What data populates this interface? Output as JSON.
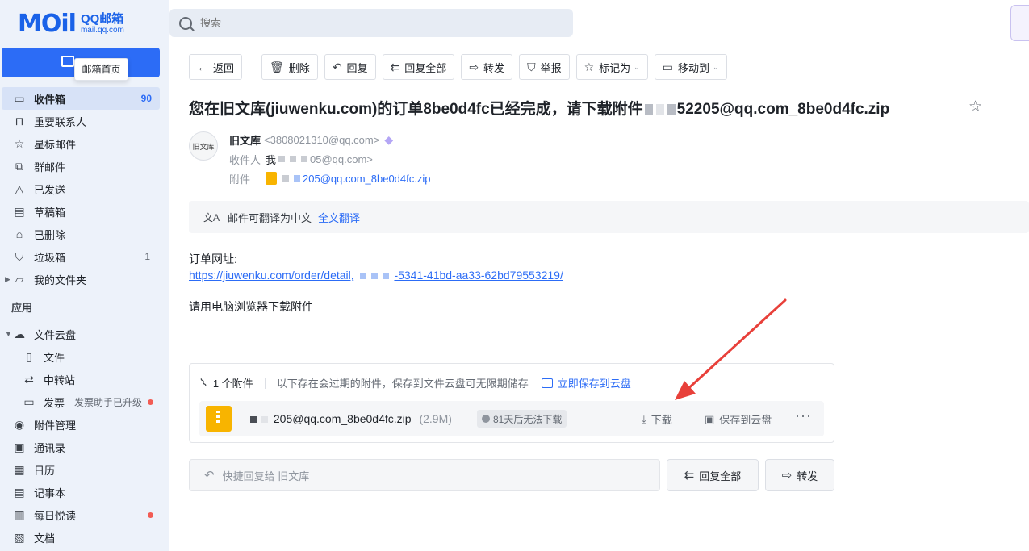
{
  "brand": {
    "mark": "MOil",
    "title": "QQ邮箱",
    "subtitle": "mail.qq.com"
  },
  "tooltip": "邮箱首页",
  "search": {
    "placeholder": "搜索"
  },
  "nav": [
    {
      "label": "收件箱",
      "count": "90",
      "icon": "inbox-icon",
      "active": true
    },
    {
      "label": "重要联系人",
      "count": "",
      "icon": "bookmark-icon"
    },
    {
      "label": "星标邮件",
      "count": "",
      "icon": "star-icon"
    },
    {
      "label": "群邮件",
      "count": "",
      "icon": "group-mail-icon"
    },
    {
      "label": "已发送",
      "count": "",
      "icon": "send-icon"
    },
    {
      "label": "草稿箱",
      "count": "",
      "icon": "draft-icon"
    },
    {
      "label": "已删除",
      "count": "",
      "icon": "trash-icon"
    },
    {
      "label": "垃圾箱",
      "count": "1",
      "icon": "spam-shield-icon"
    },
    {
      "label": "我的文件夹",
      "count": "",
      "icon": "folder-icon"
    }
  ],
  "apps": {
    "title": "应用",
    "items": [
      {
        "label": "文件云盘",
        "icon": "cloud-disk-icon"
      },
      {
        "label": "文件",
        "icon": "file-icon"
      },
      {
        "label": "中转站",
        "icon": "transfer-icon"
      },
      {
        "label": "发票",
        "note": "发票助手已升级",
        "icon": "invoice-icon"
      },
      {
        "label": "附件管理",
        "icon": "attachment-manage-icon"
      },
      {
        "label": "通讯录",
        "icon": "contacts-icon"
      },
      {
        "label": "日历",
        "icon": "calendar-icon"
      },
      {
        "label": "记事本",
        "icon": "notepad-icon"
      },
      {
        "label": "每日悦读",
        "icon": "reading-icon"
      },
      {
        "label": "文档",
        "icon": "docs-icon"
      }
    ]
  },
  "toolbar": {
    "back": "返回",
    "delete": "删除",
    "reply": "回复",
    "reply_all": "回复全部",
    "forward": "转发",
    "report": "举报",
    "mark_as": "标记为",
    "move_to": "移动到"
  },
  "mail": {
    "subject_start": "您在旧文库(jiuwenku.com)的订单8be0d4fc已经完成，请下载附件",
    "subject_end": "52205@qq.com_8be0d4fc.zip",
    "sender_name": "旧文库",
    "sender_email": "<3808021310@qq.com>",
    "avatar_text": "旧文库",
    "recipient_label": "收件人",
    "recipient_start": "我",
    "recipient_end": "05@qq.com>",
    "attachment_label": "附件",
    "attachment_name_end": "205@qq.com_8be0d4fc.zip",
    "translate_text": "邮件可翻译为中文",
    "translate_link": "全文翻译",
    "body_label": "订单网址:",
    "body_link_start": "https://jiuwenku.com/order/detail,",
    "body_link_end": "-5341-41bd-aa33-62bd79553219/",
    "body_note": "请用电脑浏览器下载附件"
  },
  "attachment": {
    "count": "1 个附件",
    "note": "以下存在会过期的附件，保存到文件云盘可无限期储存",
    "save_link": "立即保存到云盘",
    "file_name": "205@qq.com_8be0d4fc.zip",
    "file_size": "(2.9M)",
    "expire": "81天后无法下载",
    "download": "下载",
    "save_cloud": "保存到云盘",
    "more": "···"
  },
  "reply_bar": {
    "placeholder": "快捷回复给 旧文库",
    "reply_all": "回复全部",
    "forward": "转发"
  },
  "colors": {
    "accent": "#2c6cf6",
    "sidebar_bg": "#edf2fa",
    "annotation": "#e8403a"
  }
}
